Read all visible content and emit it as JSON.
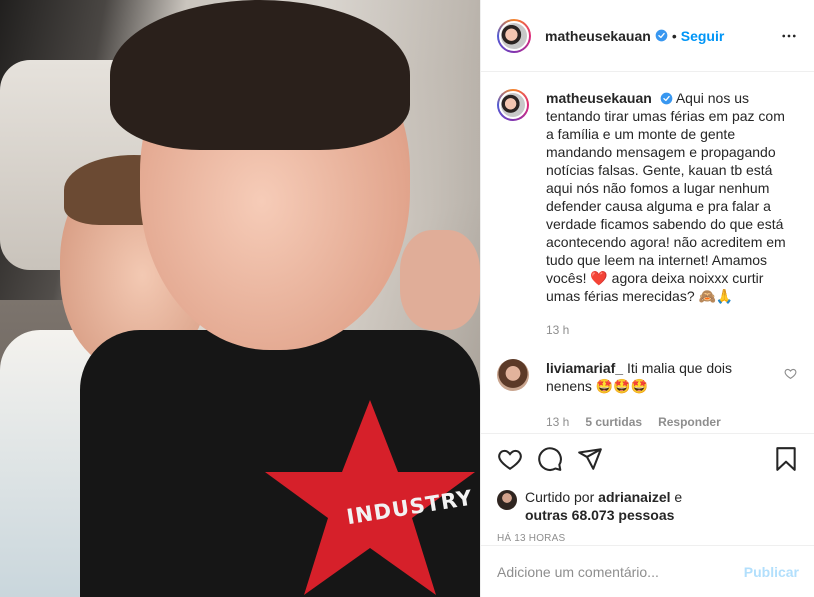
{
  "account": {
    "username": "matheusekauan",
    "verified": true,
    "separator": "•",
    "follow_label": "Seguir",
    "more_icon": "more-horizontal-icon"
  },
  "photo": {
    "shirt_text": "INDUSTRY",
    "star_color": "#d6202a"
  },
  "caption": {
    "username": "matheusekauan",
    "text": "Aqui nos us tentando tirar umas férias em paz com a família e um monte de gente mandando mensagem e propagando notícias falsas. Gente, kauan tb está aqui nós não fomos a lugar nenhum defender causa alguma e pra falar a verdade ficamos sabendo do que está acontecendo agora! não acreditem em tudo que leem na internet! Amamos vocês! ❤️ agora deixa noixxx curtir umas férias merecidas? 🙈🙏",
    "time": "13 h"
  },
  "comments": [
    {
      "username": "liviamariaf_",
      "text": "Iti malia que dois nenens 🤩🤩🤩",
      "time": "13 h",
      "likes": "5 curtidas",
      "reply_label": "Responder"
    }
  ],
  "actions": {
    "icons": [
      "heart-icon",
      "comment-icon",
      "share-icon",
      "bookmark-icon"
    ],
    "liked_prefix": "Curtido por",
    "liked_user": "adrianaizel",
    "liked_joiner": "e",
    "liked_others": "outras 68.073 pessoas",
    "timestamp": "HÁ 13 HORAS"
  },
  "add_comment": {
    "placeholder": "Adicione um comentário...",
    "publish_label": "Publicar"
  },
  "colors": {
    "link_blue": "#0095f6",
    "publish_disabled": "#b2dffc",
    "muted_text": "#8e8e8e",
    "verified_blue": "#3897f0"
  }
}
